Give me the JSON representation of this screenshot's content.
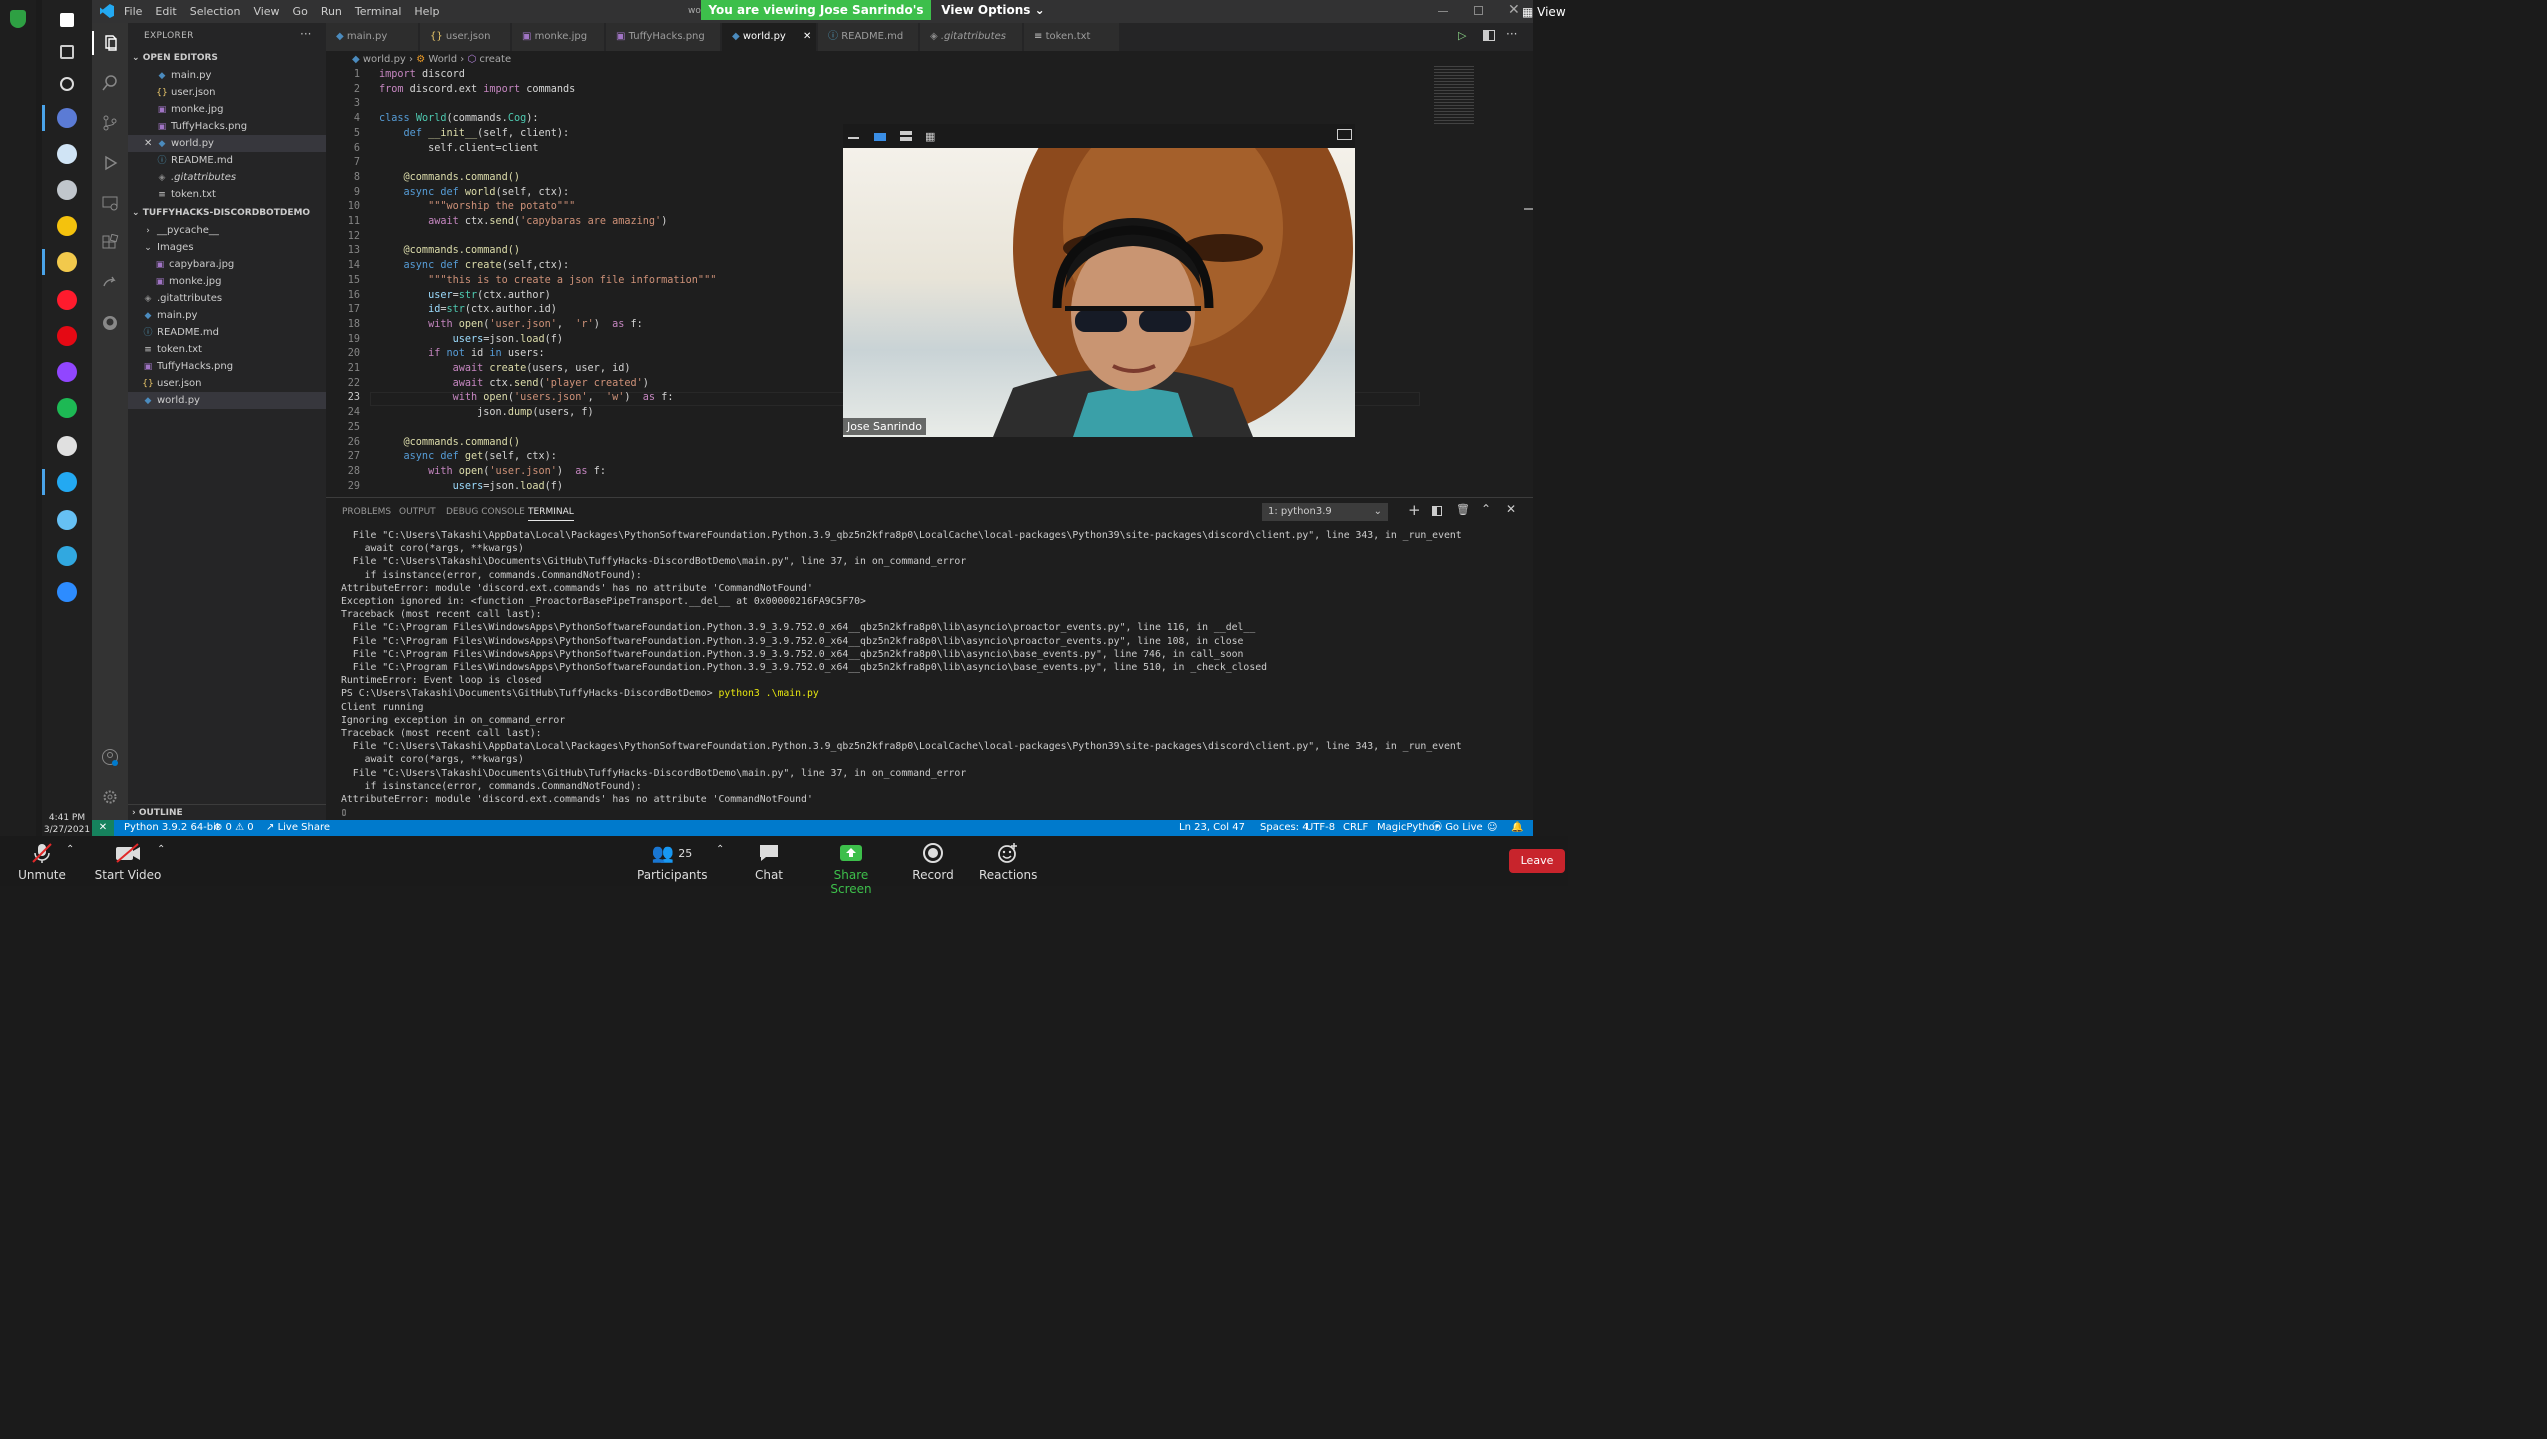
{
  "taskbar": {
    "icon_names": [
      "windows-start-icon",
      "search-icon",
      "cortana-icon",
      "zoom-notification-icon",
      "desktop-app-icon",
      "steam-like-icon",
      "chrome-icon",
      "file-explorer-icon",
      "opera-icon",
      "netflix-icon",
      "twitch-icon",
      "spotify-icon",
      "github-desktop-icon",
      "vscode-icon",
      "steam-icon",
      "edge-icon",
      "zoom-icon"
    ],
    "clock_time": "4:41 PM",
    "clock_date": "3/27/2021"
  },
  "titlebar": {
    "menus": [
      "File",
      "Edit",
      "Selection",
      "View",
      "Go",
      "Run",
      "Terminal",
      "Help"
    ],
    "title_fragment": "wo"
  },
  "zoom_banner": {
    "viewing": "You are viewing Jose Sanrindo's screen",
    "view_options": "View Options",
    "view": "View"
  },
  "sidebar": {
    "title": "EXPLORER",
    "open_editors": "OPEN EDITORS",
    "open_files": [
      {
        "name": "main.py",
        "icon": "py"
      },
      {
        "name": "user.json",
        "icon": "json"
      },
      {
        "name": "monke.jpg",
        "icon": "img"
      },
      {
        "name": "TuffyHacks.png",
        "icon": "img"
      },
      {
        "name": "world.py",
        "icon": "py",
        "selected": true
      },
      {
        "name": "README.md",
        "icon": "info"
      },
      {
        "name": ".gitattributes",
        "icon": "git"
      },
      {
        "name": "token.txt",
        "icon": "txt"
      }
    ],
    "project": "TUFFYHACKS-DISCORDBOTDEMO",
    "tree": [
      {
        "name": "__pycache__",
        "indent": 1,
        "icon": ">"
      },
      {
        "name": "Images",
        "indent": 1,
        "icon": "v"
      },
      {
        "name": "capybara.jpg",
        "indent": 2,
        "icon": "img"
      },
      {
        "name": "monke.jpg",
        "indent": 2,
        "icon": "img"
      },
      {
        "name": ".gitattributes",
        "indent": 1,
        "icon": "git"
      },
      {
        "name": "main.py",
        "indent": 1,
        "icon": "py"
      },
      {
        "name": "README.md",
        "indent": 1,
        "icon": "info"
      },
      {
        "name": "token.txt",
        "indent": 1,
        "icon": "txt"
      },
      {
        "name": "TuffyHacks.png",
        "indent": 1,
        "icon": "img"
      },
      {
        "name": "user.json",
        "indent": 1,
        "icon": "json"
      },
      {
        "name": "world.py",
        "indent": 1,
        "icon": "py",
        "selected": true
      }
    ],
    "outline": "OUTLINE"
  },
  "tabs": [
    {
      "label": "main.py",
      "icon": "py"
    },
    {
      "label": "user.json",
      "icon": "json"
    },
    {
      "label": "monke.jpg",
      "icon": "img"
    },
    {
      "label": "TuffyHacks.png",
      "icon": "img"
    },
    {
      "label": "world.py",
      "icon": "py",
      "active": true
    },
    {
      "label": "README.md",
      "icon": "info"
    },
    {
      "label": ".gitattributes",
      "icon": "git"
    },
    {
      "label": "token.txt",
      "icon": "txt"
    }
  ],
  "breadcrumb": {
    "file": "world.py",
    "cls": "World",
    "method": "create"
  },
  "code": [
    {
      "n": "1",
      "t": [
        [
          "kc",
          "import"
        ],
        [
          "",
          "discord"
        ]
      ]
    },
    {
      "n": "2",
      "t": [
        [
          "kc",
          "from"
        ],
        [
          "",
          "discord.ext"
        ],
        [
          "kc",
          "import"
        ],
        [
          "",
          "commands"
        ]
      ]
    },
    {
      "n": "3",
      "t": []
    },
    {
      "n": "4",
      "t": [
        [
          "kw",
          "class"
        ],
        [
          "cls",
          "World"
        ],
        [
          "",
          "(commands."
        ],
        [
          "cls",
          "Cog"
        ],
        [
          "",
          "):"
        ]
      ]
    },
    {
      "n": "5",
      "t": [
        [
          "",
          "    "
        ],
        [
          "kw",
          "def"
        ],
        [
          "fn",
          "__init__"
        ],
        [
          "",
          "(self, client):"
        ]
      ]
    },
    {
      "n": "6",
      "t": [
        [
          "",
          "        self.client=client"
        ]
      ]
    },
    {
      "n": "7",
      "t": []
    },
    {
      "n": "8",
      "t": [
        [
          "fn",
          "    @commands.command()"
        ]
      ]
    },
    {
      "n": "9",
      "t": [
        [
          "kw",
          "    async"
        ],
        [
          "kw",
          "def"
        ],
        [
          "fn",
          "world"
        ],
        [
          "",
          "(self, ctx):"
        ]
      ]
    },
    {
      "n": "10",
      "t": [
        [
          "st",
          "        \"\"\"worship the potato\"\"\""
        ]
      ]
    },
    {
      "n": "11",
      "t": [
        [
          "kc",
          "        await"
        ],
        [
          "",
          "ctx."
        ],
        [
          "fn",
          "send"
        ],
        [
          "",
          "("
        ],
        [
          "st",
          "'capybaras are amazing'"
        ],
        [
          "",
          ")"
        ]
      ]
    },
    {
      "n": "12",
      "t": []
    },
    {
      "n": "13",
      "t": [
        [
          "fn",
          "    @commands.command()"
        ]
      ]
    },
    {
      "n": "14",
      "t": [
        [
          "kw",
          "    async"
        ],
        [
          "kw",
          "def"
        ],
        [
          "fn",
          "create"
        ],
        [
          "",
          "(self,ctx):"
        ]
      ]
    },
    {
      "n": "15",
      "t": [
        [
          "st",
          "        \"\"\"this is to create a json file information\"\"\""
        ]
      ]
    },
    {
      "n": "16",
      "t": [
        [
          "vr",
          "        user"
        ],
        [
          "",
          "="
        ],
        [
          "cls",
          "str"
        ],
        [
          "",
          "(ctx.author)"
        ]
      ]
    },
    {
      "n": "17",
      "t": [
        [
          "vr",
          "        id"
        ],
        [
          "",
          "="
        ],
        [
          "cls",
          "str"
        ],
        [
          "",
          "(ctx.author.id)"
        ]
      ]
    },
    {
      "n": "18",
      "t": [
        [
          "kc",
          "        with"
        ],
        [
          "fn",
          "open"
        ],
        [
          "",
          "("
        ],
        [
          "st",
          "'user.json'"
        ],
        [
          "",
          ", "
        ],
        [
          "st",
          "'r'"
        ],
        [
          "",
          ") "
        ],
        [
          "kc",
          "as"
        ],
        [
          "",
          "f:"
        ]
      ]
    },
    {
      "n": "19",
      "t": [
        [
          "vr",
          "            users"
        ],
        [
          "",
          "=json."
        ],
        [
          "fn",
          "load"
        ],
        [
          "",
          "(f)"
        ]
      ]
    },
    {
      "n": "20",
      "t": [
        [
          "kc",
          "        if"
        ],
        [
          "kw",
          "not"
        ],
        [
          "",
          "id"
        ],
        [
          "kw",
          "in"
        ],
        [
          "",
          "users:"
        ]
      ]
    },
    {
      "n": "21",
      "t": [
        [
          "kc",
          "            await"
        ],
        [
          "fn",
          "create"
        ],
        [
          "",
          "(users, user, id)"
        ]
      ]
    },
    {
      "n": "22",
      "t": [
        [
          "kc",
          "            await"
        ],
        [
          "",
          "ctx."
        ],
        [
          "fn",
          "send"
        ],
        [
          "",
          "("
        ],
        [
          "st",
          "'player created'"
        ],
        [
          "",
          ")"
        ]
      ]
    },
    {
      "n": "23",
      "t": [
        [
          "kc",
          "            with"
        ],
        [
          "fn",
          "open"
        ],
        [
          "",
          "("
        ],
        [
          "st",
          "'users.json'"
        ],
        [
          "",
          ", "
        ],
        [
          "st",
          "'w'"
        ],
        [
          "",
          ") "
        ],
        [
          "kc",
          "as"
        ],
        [
          "",
          "f:"
        ]
      ]
    },
    {
      "n": "24",
      "t": [
        [
          "",
          "                json."
        ],
        [
          "fn",
          "dump"
        ],
        [
          "",
          "(users, f)"
        ]
      ]
    },
    {
      "n": "25",
      "t": []
    },
    {
      "n": "26",
      "t": [
        [
          "fn",
          "    @commands.command()"
        ]
      ]
    },
    {
      "n": "27",
      "t": [
        [
          "kw",
          "    async"
        ],
        [
          "kw",
          "def"
        ],
        [
          "fn",
          "get"
        ],
        [
          "",
          "(self, ctx):"
        ]
      ]
    },
    {
      "n": "28",
      "t": [
        [
          "kc",
          "        with"
        ],
        [
          "fn",
          "open"
        ],
        [
          "",
          "("
        ],
        [
          "st",
          "'user.json'"
        ],
        [
          "",
          ") "
        ],
        [
          "kc",
          "as"
        ],
        [
          "",
          "f:"
        ]
      ]
    },
    {
      "n": "29",
      "t": [
        [
          "vr",
          "            users"
        ],
        [
          "",
          "=json."
        ],
        [
          "fn",
          "load"
        ],
        [
          "",
          "(f)"
        ]
      ]
    }
  ],
  "video": {
    "name": "Jose Sanrindo"
  },
  "panel": {
    "tabs": [
      "PROBLEMS",
      "OUTPUT",
      "DEBUG CONSOLE",
      "TERMINAL"
    ],
    "terminal_select": "1: python3.9"
  },
  "terminal": [
    "  File \"C:\\Users\\Takashi\\AppData\\Local\\Packages\\PythonSoftwareFoundation.Python.3.9_qbz5n2kfra8p0\\LocalCache\\local-packages\\Python39\\site-packages\\discord\\client.py\", line 343, in _run_event",
    "    await coro(*args, **kwargs)",
    "  File \"C:\\Users\\Takashi\\Documents\\GitHub\\TuffyHacks-DiscordBotDemo\\main.py\", line 37, in on_command_error",
    "    if isinstance(error, commands.CommandNotFound):",
    "AttributeError: module 'discord.ext.commands' has no attribute 'CommandNotFound'",
    "Exception ignored in: <function _ProactorBasePipeTransport.__del__ at 0x00000216FA9C5F70>",
    "Traceback (most recent call last):",
    "  File \"C:\\Program Files\\WindowsApps\\PythonSoftwareFoundation.Python.3.9_3.9.752.0_x64__qbz5n2kfra8p0\\lib\\asyncio\\proactor_events.py\", line 116, in __del__",
    "  File \"C:\\Program Files\\WindowsApps\\PythonSoftwareFoundation.Python.3.9_3.9.752.0_x64__qbz5n2kfra8p0\\lib\\asyncio\\proactor_events.py\", line 108, in close",
    "  File \"C:\\Program Files\\WindowsApps\\PythonSoftwareFoundation.Python.3.9_3.9.752.0_x64__qbz5n2kfra8p0\\lib\\asyncio\\base_events.py\", line 746, in call_soon",
    "  File \"C:\\Program Files\\WindowsApps\\PythonSoftwareFoundation.Python.3.9_3.9.752.0_x64__qbz5n2kfra8p0\\lib\\asyncio\\base_events.py\", line 510, in _check_closed",
    "RuntimeError: Event loop is closed",
    "PS C:\\Users\\Takashi\\Documents\\GitHub\\TuffyHacks-DiscordBotDemo> ",
    "Client running",
    "Ignoring exception in on_command_error",
    "Traceback (most recent call last):",
    "  File \"C:\\Users\\Takashi\\AppData\\Local\\Packages\\PythonSoftwareFoundation.Python.3.9_qbz5n2kfra8p0\\LocalCache\\local-packages\\Python39\\site-packages\\discord\\client.py\", line 343, in _run_event",
    "    await coro(*args, **kwargs)",
    "  File \"C:\\Users\\Takashi\\Documents\\GitHub\\TuffyHacks-DiscordBotDemo\\main.py\", line 37, in on_command_error",
    "    if isinstance(error, commands.CommandNotFound):",
    "AttributeError: module 'discord.ext.commands' has no attribute 'CommandNotFound'",
    "▯"
  ],
  "terminal_cmd": "python3 .\\main.py",
  "status": {
    "python": "Python 3.9.2 64-bit",
    "problems": "⊗ 0 ⚠ 0",
    "liveshare": "Live Share",
    "position": "Ln 23, Col 47",
    "spaces": "Spaces: 4",
    "encoding": "UTF-8",
    "eol": "CRLF",
    "lang": "MagicPython",
    "golive": "Go Live"
  },
  "zoom_bar": {
    "unmute": "Unmute",
    "start_video": "Start Video",
    "participants": "Participants",
    "participants_count": "25",
    "chat": "Chat",
    "share": "Share Screen",
    "record": "Record",
    "reactions": "Reactions",
    "leave": "Leave"
  },
  "colors": {
    "vscode_blue": "#007acc",
    "zoom_green": "#3dbf4b",
    "leave_red": "#c8242c"
  }
}
